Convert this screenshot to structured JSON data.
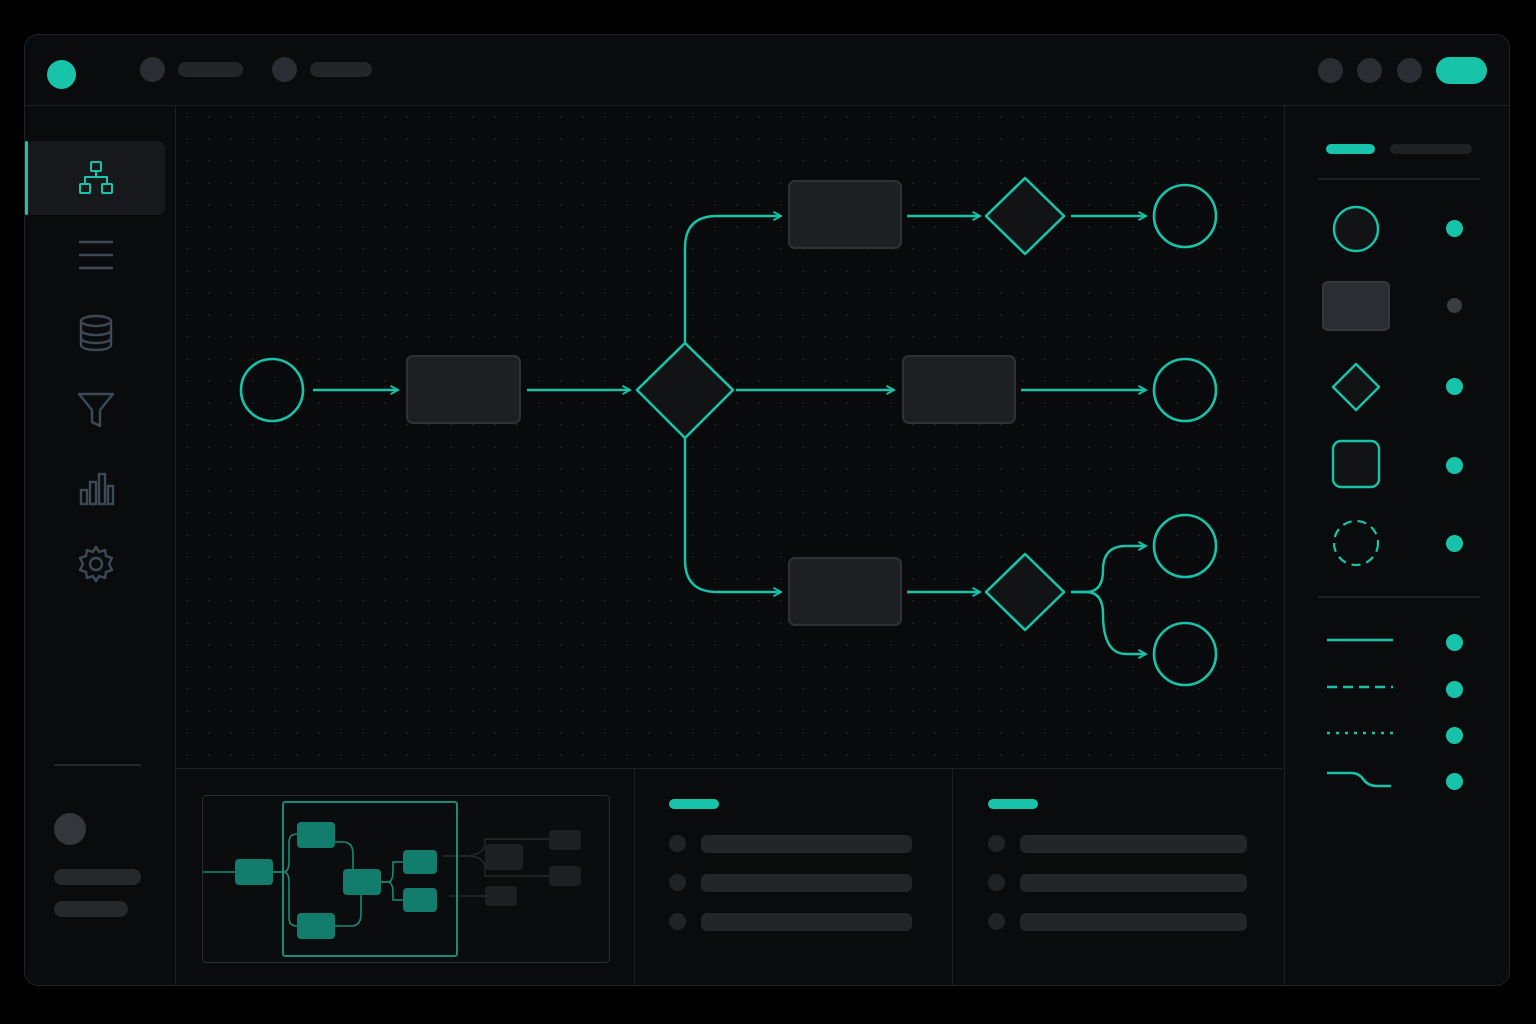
{
  "colors": {
    "accent": "#17c4aa",
    "node_fill": "#1d1f22",
    "node_stroke": "#2e3236",
    "muted": "#2a2d31",
    "icon": "#3d4a55"
  },
  "sidebar": {
    "items": [
      {
        "icon": "diagram-icon",
        "active": true
      },
      {
        "icon": "list-icon",
        "active": false
      },
      {
        "icon": "database-icon",
        "active": false
      },
      {
        "icon": "filter-icon",
        "active": false
      },
      {
        "icon": "bar-chart-icon",
        "active": false
      },
      {
        "icon": "gear-icon",
        "active": false
      }
    ]
  },
  "palette": {
    "shapes": [
      "circle-shape-icon",
      "rectangle-shape-icon",
      "diamond-shape-icon",
      "rounded-square-shape-icon",
      "dashed-circle-shape-icon"
    ],
    "lines": [
      "solid-line-icon",
      "dashed-line-icon",
      "dotted-line-icon",
      "curved-line-icon"
    ]
  }
}
